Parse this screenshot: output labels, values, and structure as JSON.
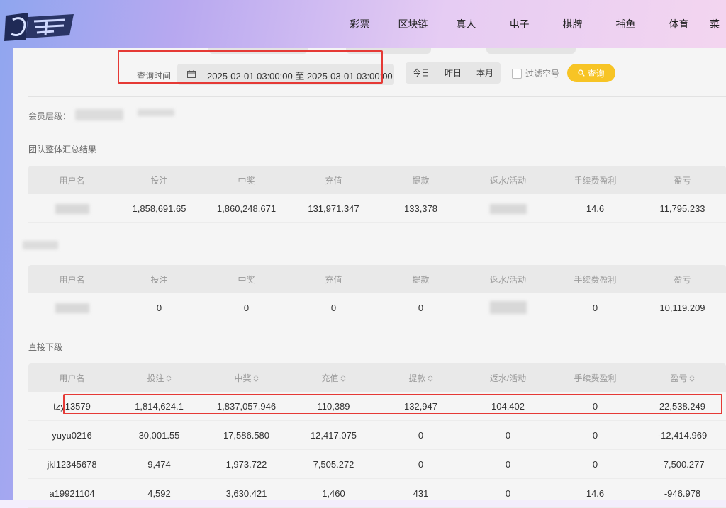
{
  "nav": [
    "彩票",
    "区块链",
    "真人",
    "电子",
    "棋牌",
    "捕鱼",
    "体育",
    "菜"
  ],
  "filter": {
    "query_label": "查询时间",
    "date_range": "2025-02-01 03:00:00 至 2025-03-01 03:00:00",
    "quick": [
      "今日",
      "昨日",
      "本月"
    ],
    "filter_empty_label": "过滤空号",
    "search_label": "查询"
  },
  "member_level_label": "会员层级：",
  "team_summary": {
    "title": "团队整体汇总结果",
    "headers": [
      "用户名",
      "投注",
      "中奖",
      "充值",
      "提款",
      "返水/活动",
      "手续费盈利",
      "盈亏"
    ],
    "row": [
      "",
      "1,858,691.65",
      "1,860,248.671",
      "131,971.347",
      "133,378",
      "",
      "14.6",
      "11,795.233"
    ]
  },
  "self_summary": {
    "headers": [
      "用户名",
      "投注",
      "中奖",
      "充值",
      "提款",
      "返水/活动",
      "手续费盈利",
      "盈亏"
    ],
    "row": [
      "",
      "0",
      "0",
      "0",
      "0",
      "",
      "0",
      "10,119.209"
    ]
  },
  "direct": {
    "title": "直接下级",
    "headers": [
      "用户名",
      "投注",
      "中奖",
      "充值",
      "提款",
      "返水/活动",
      "手续费盈利",
      "盈亏"
    ],
    "rows": [
      [
        "tzy13579",
        "1,814,624.1",
        "1,837,057.946",
        "110,389",
        "132,947",
        "104.402",
        "0",
        "22,538.249"
      ],
      [
        "yuyu0216",
        "30,001.55",
        "17,586.580",
        "12,417.075",
        "0",
        "0",
        "0",
        "-12,414.969"
      ],
      [
        "jkl12345678",
        "9,474",
        "1,973.722",
        "7,505.272",
        "0",
        "0",
        "0",
        "-7,500.277"
      ],
      [
        "a19921104",
        "4,592",
        "3,630.421",
        "1,460",
        "431",
        "0",
        "14.6",
        "-946.978"
      ]
    ]
  },
  "colors": {
    "accent": "#f7c425",
    "highlight": "#e53935"
  }
}
